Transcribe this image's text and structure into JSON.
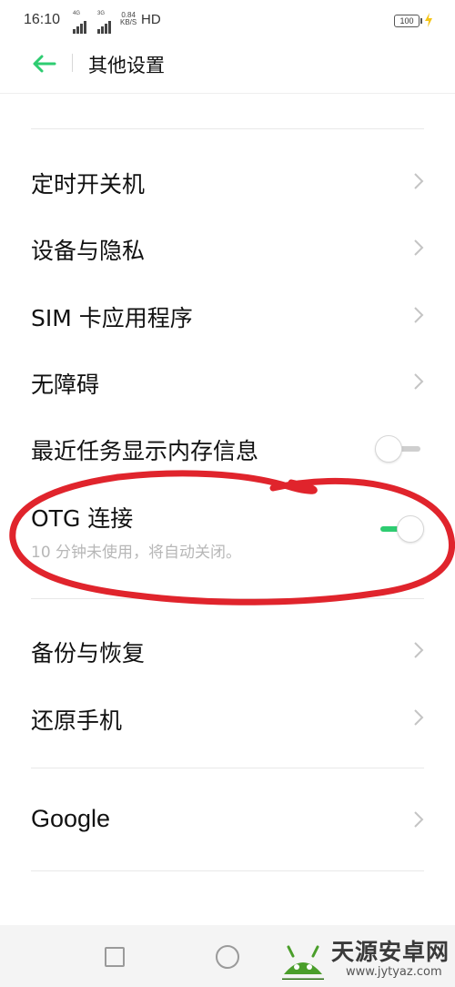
{
  "status_bar": {
    "time": "16:10",
    "net1_tag": "4G",
    "net2_tag": "3G",
    "speed_value": "0.84",
    "speed_unit": "KB/S",
    "hd": "HD",
    "battery": "100",
    "charging": true
  },
  "header": {
    "title": "其他设置",
    "accent_color": "#2ecc71"
  },
  "settings": {
    "timer_power": "定时开关机",
    "device_privacy": "设备与隐私",
    "sim_apps": "SIM 卡应用程序",
    "accessibility": "无障碍",
    "recent_memory": {
      "label": "最近任务显示内存信息",
      "enabled": false
    },
    "otg": {
      "label": "OTG 连接",
      "description": "10 分钟未使用，将自动关闭。",
      "enabled": true
    },
    "backup": "备份与恢复",
    "reset": "还原手机",
    "google": "Google"
  },
  "annotation": {
    "color": "#e0242c",
    "shape": "hand-drawn-ellipse"
  },
  "nav_bar": {
    "recent": "square-icon",
    "home": "circle-icon"
  },
  "watermark": {
    "name": "天源安卓网",
    "url": "www.jytyaz.com"
  }
}
